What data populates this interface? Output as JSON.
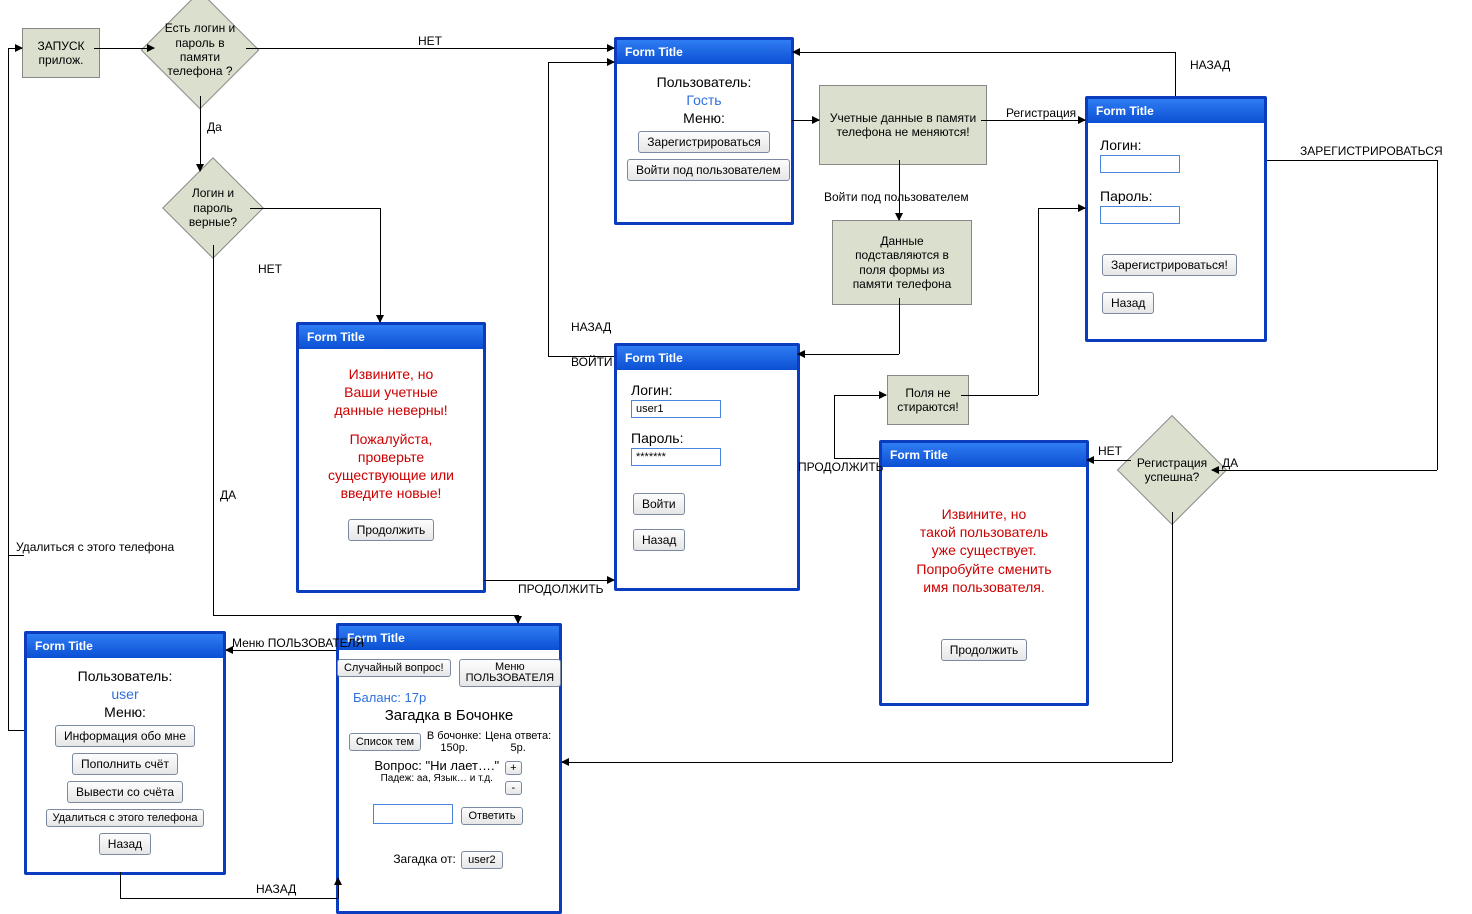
{
  "start_block": "ЗАПУСК\nприлож.",
  "decision_has_login": "Есть логин и\nпароль в\nпамяти\nтелефона ?",
  "decision_login_correct": "Логин и\nпароль\nверные?",
  "process_creds_unchanged": "Учетные данные в памяти\nтелефона не меняются!",
  "process_data_substituted": "Данные\nподставляются в\nполя формы из\nпамяти телефона",
  "process_fields_not_cleared": "Поля не\nстираются!",
  "decision_reg_ok": "Регистрация\nуспешна?",
  "edges": {
    "no": "НЕТ",
    "yes_small": "Да",
    "yes_caps": "ДА",
    "back": "НАЗАД",
    "registration": "Регистрация",
    "register_caps": "ЗАРЕГИСТРИРОВАТЬСЯ",
    "login_under_user": "Войти под пользователем",
    "continue": "ПРОДОЛЖИТЬ",
    "enter": "ВОЙТИ",
    "delete_from_phone": "Удалиться с этого телефона",
    "user_menu": "Меню ПОЛЬЗОВАТЕЛЯ"
  },
  "form_title": "Form Title",
  "form_guest": {
    "user_label": "Пользователь:",
    "user_value": "Гость",
    "menu_label": "Меню:",
    "btn_register": "Зарегистрироваться",
    "btn_login_as_user": "Войти под пользователем"
  },
  "form_register": {
    "login_label": "Логин:",
    "password_label": "Пароль:",
    "btn_register": "Зарегистрироваться!",
    "btn_back": "Назад"
  },
  "form_error_creds": {
    "line1": "Извините, но\nВаши учетные\nданные неверны!",
    "line2": "Пожалуйста,\nпроверьте\nсуществующие или\nвведите новые!",
    "btn_continue": "Продолжить"
  },
  "form_login": {
    "login_label": "Логин:",
    "login_value": "user1",
    "password_label": "Пароль:",
    "password_value": "*******",
    "btn_login": "Войти",
    "btn_back": "Назад"
  },
  "form_reg_error": {
    "text": "Извините, но\nтакой пользователь\nуже существует.\nПопробуйте сменить\nимя пользователя.",
    "btn_continue": "Продолжить"
  },
  "form_user_menu": {
    "user_label": "Пользователь:",
    "user_value": "user",
    "menu_label": "Меню:",
    "btn_info": "Информация обо мне",
    "btn_topup": "Пополнить счёт",
    "btn_withdraw": "Вывести со счёта",
    "btn_delete": "Удалиться с этого телефона",
    "btn_back": "Назад"
  },
  "form_riddle": {
    "btn_random": "Случайный вопрос!",
    "btn_user_menu": "Меню\nПОЛЬЗОВАТЕЛЯ",
    "balance": "Баланс: 17р",
    "heading": "Загадка в Бочонке",
    "btn_topics": "Список тем",
    "in_barrel_label": "В бочонке:",
    "in_barrel_value": "150р.",
    "answer_price_label": "Цена ответа:",
    "answer_price_value": "5р.",
    "question": "Вопрос: \"Ни лает….\"",
    "hint": "Падеж: аа, Язык… и т.д.",
    "btn_plus": "+",
    "btn_minus": "-",
    "btn_answer": "Ответить",
    "riddle_from": "Загадка от:",
    "riddle_author": "user2"
  }
}
